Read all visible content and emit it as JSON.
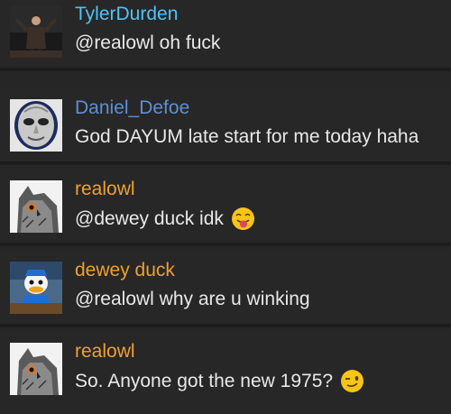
{
  "messages": [
    {
      "username": "TylerDurden",
      "username_color": "#4fc3f7",
      "text": "@realowl oh fuck",
      "avatar": "man-with-raised-arms-avatar",
      "emoji": null
    },
    {
      "username": "Daniel_Defoe",
      "username_color": "#5e8fd6",
      "text": "God DAYUM late start for me today haha",
      "avatar": "guy-fawkes-mask-avatar",
      "emoji": null
    },
    {
      "username": "realowl",
      "username_color": "#f0a030",
      "text": "@dewey duck idk",
      "avatar": "owl-avatar",
      "emoji": "tongue-out-emoji"
    },
    {
      "username": "dewey duck",
      "username_color": "#f0a030",
      "text": "@realowl why are u winking",
      "avatar": "cartoon-duck-avatar",
      "emoji": null
    },
    {
      "username": "realowl",
      "username_color": "#f0a030",
      "text": "So. Anyone got the new 1975?",
      "avatar": "owl-avatar",
      "emoji": "winking-emoji"
    }
  ]
}
